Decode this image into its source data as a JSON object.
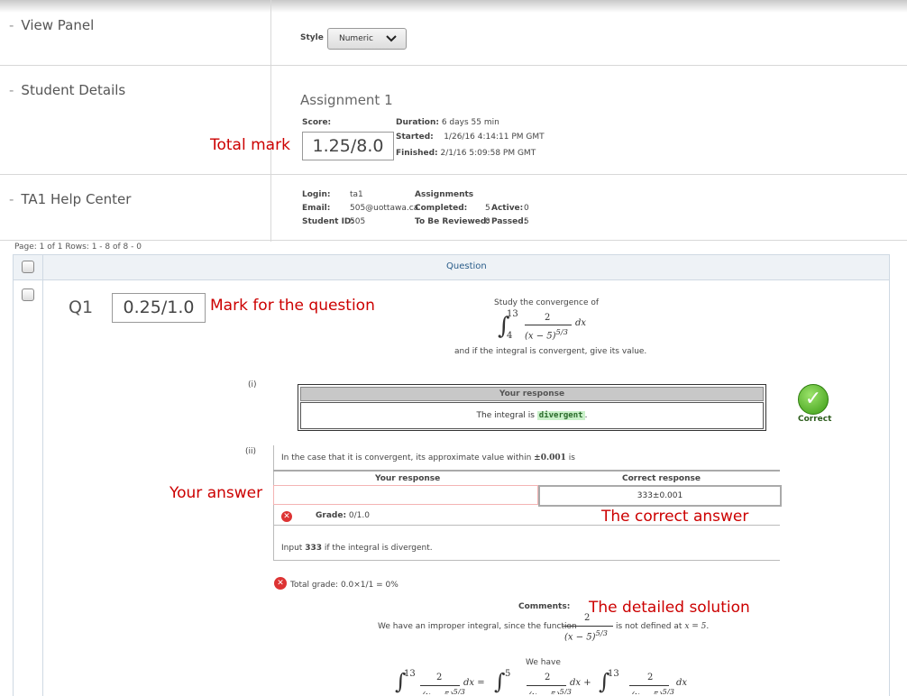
{
  "nav": {
    "view_panel": "View Panel",
    "student_details": "Student Details",
    "help_center": "TA1 Help Center"
  },
  "style": {
    "label": "Style",
    "value": "Numeric"
  },
  "assignment": {
    "title": "Assignment 1",
    "score_label": "Score:",
    "score": "1.25/8.0",
    "duration_label": "Duration:",
    "duration": "6 days 55 min",
    "started_label": "Started:",
    "started": "1/26/16 4:14:11 PM GMT",
    "finished_label": "Finished:",
    "finished": "2/1/16 5:09:58 PM GMT"
  },
  "student": {
    "login_label": "Login:",
    "login": "ta1",
    "email_label": "Email:",
    "email": "505@uottawa.ca",
    "id_label": "Student ID:",
    "id": "505",
    "assign_label": "Assignments",
    "completed_label": "Completed:",
    "completed": "5",
    "active_label": "Active:",
    "active": "0",
    "review_label": "To Be Reviewed:",
    "review": "0",
    "passed_label": "Passed:",
    "passed": "5"
  },
  "pager": "Page: 1 of 1 Rows: 1 - 8 of 8   -   0",
  "grid": {
    "question_header": "Question"
  },
  "question": {
    "id": "Q1",
    "mark": "0.25/1.0",
    "prompt": "Study the convergence of",
    "prompt2": "and if the integral is convergent, give its value.",
    "part_i": "(i)",
    "your_response": "Your response",
    "resp_i_prefix": "The integral is",
    "resp_i_value": "divergent",
    "correct_label": "Correct",
    "part_ii": "(ii)",
    "part_ii_text": "In the case that it is convergent, its approximate value within",
    "part_ii_tol": "±0.001",
    "part_ii_is": "is",
    "col_yours": "Your response",
    "col_correct": "Correct response",
    "correct_value": "333±0.001",
    "grade_label": "Grade:",
    "grade": "0/1.0",
    "hint_pre": "Input",
    "hint_num": "333",
    "hint_post": "if the integral is divergent.",
    "total_grade": "Total grade: 0.0×1/1 = 0%",
    "comments_label": "Comments:",
    "comment_pre": "We have an improper integral, since the function",
    "comment_post": "is not defined at",
    "comment_x": "x = 5.",
    "we_have": "We have"
  },
  "annotations": {
    "total_mark": "Total mark",
    "mark_q": "Mark for the question",
    "your_answer": "Your answer",
    "correct_answer": "The correct answer",
    "detailed_solution": "The detailed solution"
  }
}
